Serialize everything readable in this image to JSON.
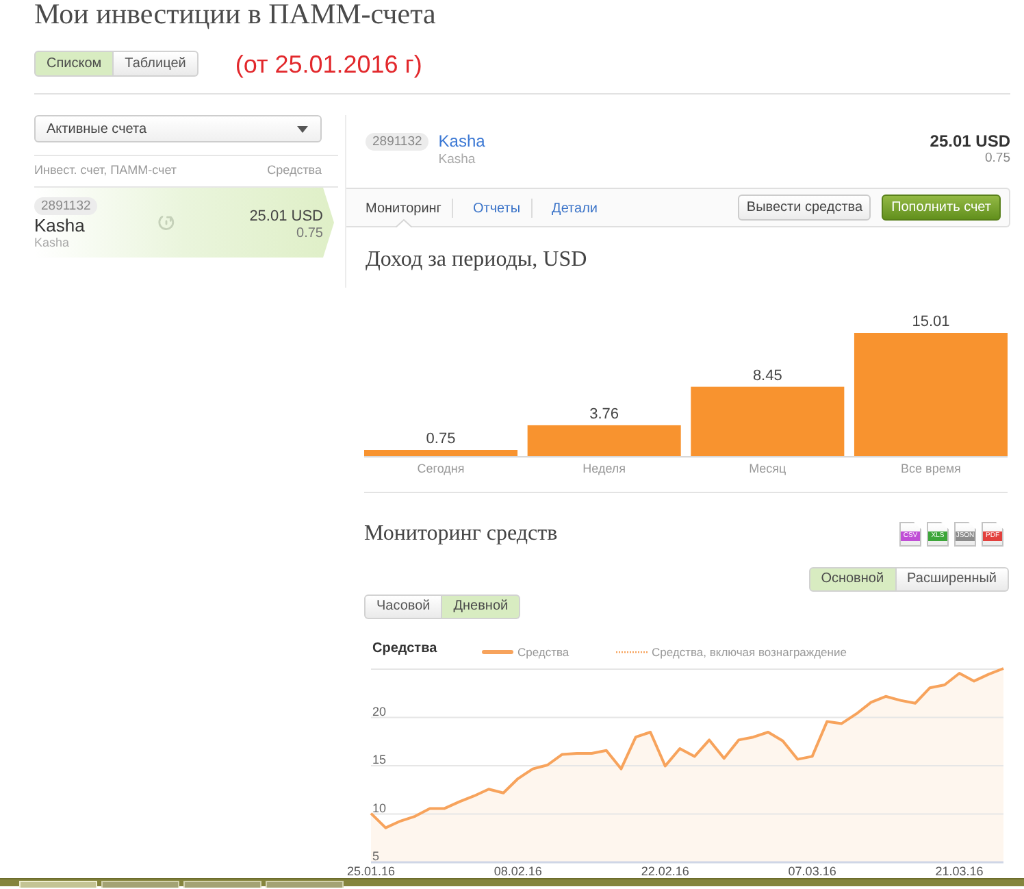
{
  "header": {
    "title": "Мои инвестиции в ПАММ-счета",
    "view_toggle": [
      {
        "label": "Списком",
        "selected": true
      },
      {
        "label": "Таблицей",
        "selected": false
      }
    ],
    "date_note": "(от 25.01.2016 г)"
  },
  "sidebar": {
    "filter": {
      "value": "Активные счета"
    },
    "columns": [
      "Инвест. счет, ПАММ-счет",
      "Средства"
    ],
    "accounts": [
      {
        "number": "2891132",
        "name": "Kasha",
        "subtitle": "Kasha",
        "balance": "25.01 USD",
        "profit": "0.75",
        "selected": true
      }
    ]
  },
  "account": {
    "number": "2891132",
    "name": "Kasha",
    "subtitle": "Kasha",
    "balance": "25.01 USD",
    "profit": "0.75",
    "tabs": [
      {
        "label": "Мониторинг",
        "selected": true
      },
      {
        "label": "Отчеты",
        "selected": false
      },
      {
        "label": "Детали",
        "selected": false
      }
    ],
    "buttons": [
      {
        "label": "Вывести средства",
        "kind": "secondary"
      },
      {
        "label": "Пополнить счет",
        "kind": "primary"
      }
    ]
  },
  "income": {
    "chart_data": {
      "type": "bar",
      "title": "Доход за периоды, USD",
      "categories": [
        "Сегодня",
        "Неделя",
        "Месяц",
        "Все время"
      ],
      "values": [
        0.75,
        3.76,
        8.45,
        15.01
      ],
      "data_labels": true
    }
  },
  "monitoring": {
    "title": "Мониторинг средств",
    "exports": [
      {
        "label": "CSV",
        "color": "#c04fd6"
      },
      {
        "label": "XLS",
        "color": "#3da63a"
      },
      {
        "label": "JSON",
        "color": "#8c8c8c"
      },
      {
        "label": "PDF",
        "color": "#e2403d"
      }
    ],
    "view_toggle": [
      {
        "label": "Основной",
        "selected": true
      },
      {
        "label": "Расширенный",
        "selected": false
      }
    ],
    "period_toggle": [
      {
        "label": "Часовой",
        "selected": false
      },
      {
        "label": "Дневной",
        "selected": true
      }
    ],
    "legend": [
      {
        "kind": "solid"
      },
      {
        "kind": "dotted"
      }
    ],
    "chart_data": {
      "type": "area",
      "title": "Средства",
      "grid": true,
      "categories": [
        "25.01.16",
        null,
        null,
        null,
        null,
        null,
        null,
        null,
        null,
        null,
        "08.02.16",
        null,
        null,
        null,
        null,
        null,
        null,
        null,
        null,
        null,
        "22.02.16",
        null,
        null,
        null,
        null,
        null,
        null,
        null,
        null,
        null,
        "07.03.16",
        null,
        null,
        null,
        null,
        null,
        null,
        null,
        null,
        null,
        "21.03.16",
        null,
        null,
        null
      ],
      "ylim": [
        5,
        25
      ],
      "yticks": [
        5,
        10,
        15,
        20
      ],
      "series": [
        {
          "name": "Средства",
          "color": "#f7a35c",
          "values": [
            10.0,
            8.5,
            9.2,
            9.7,
            10.5,
            10.5,
            11.2,
            11.8,
            12.5,
            12.1,
            13.6,
            14.6,
            15.0,
            16.1,
            16.2,
            16.2,
            16.5,
            14.6,
            17.9,
            18.4,
            14.9,
            16.7,
            15.9,
            17.6,
            15.7,
            17.6,
            17.9,
            18.4,
            17.5,
            15.6,
            15.9,
            19.5,
            19.3,
            20.3,
            21.5,
            22.1,
            21.7,
            21.4,
            23.0,
            23.3,
            24.5,
            23.7,
            24.4,
            25.0
          ]
        },
        {
          "name": "Средства, включая вознаграждение",
          "color": "#f7a35c",
          "values": [
            null,
            null,
            null,
            null,
            null,
            null,
            null,
            null,
            null,
            null,
            null,
            null,
            null,
            null,
            null,
            null,
            null,
            null,
            null,
            null,
            null,
            null,
            null,
            null,
            null,
            null,
            null,
            null,
            null,
            null,
            null,
            null,
            null,
            null,
            null,
            null,
            null,
            null,
            null,
            null,
            null,
            null,
            null,
            null
          ]
        }
      ]
    }
  },
  "taskbar": {
    "items": [
      {
        "selected": true
      },
      {
        "selected": false
      },
      {
        "selected": false
      },
      {
        "selected": false
      }
    ]
  }
}
